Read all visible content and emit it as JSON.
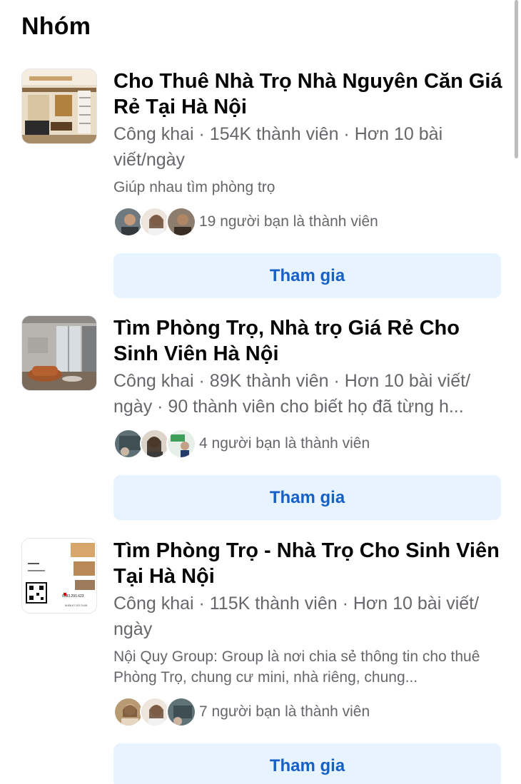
{
  "section": {
    "title": "Nhóm"
  },
  "groups": [
    {
      "name": "Cho Thuê Nhà Trọ Nhà Nguyên Căn Giá Rẻ Tại Hà Nội",
      "meta": "Công khai · 154K thành viên · Hơn 10 bài viết/ngày",
      "description": "Giúp nhau tìm phòng trọ",
      "friends_text": "19 người bạn là thành viên",
      "join_label": "Tham gia"
    },
    {
      "name": "Tìm Phòng Trọ, Nhà trọ Giá Rẻ Cho Sinh Viên Hà Nội",
      "meta": "Công khai · 89K thành viên · Hơn 10 bài viết/ ngày · 90 thành viên cho biết họ đã từng h...",
      "description": "",
      "friends_text": "4 người bạn là thành viên",
      "join_label": "Tham gia"
    },
    {
      "name": "Tìm Phòng Trọ - Nhà Trọ Cho Sinh Viên Tại Hà Nội",
      "meta": "Công khai · 115K thành viên · Hơn 10 bài viết/ ngày",
      "description": "Nội Quy Group: Group là nơi chia sẻ thông tin cho thuê Phòng Trọ, chung cư mini, nhà riêng, chung...",
      "friends_text": "7 người bạn là thành viên",
      "join_label": "Tham gia"
    }
  ],
  "thumb3_text": {
    "phone": "0383.291.623",
    "caption": "NHẬN KÝ GỬI CHUN"
  },
  "colors": {
    "accent": "#1660c6",
    "button_bg": "#e7f3ff",
    "secondary_text": "#65676b"
  }
}
